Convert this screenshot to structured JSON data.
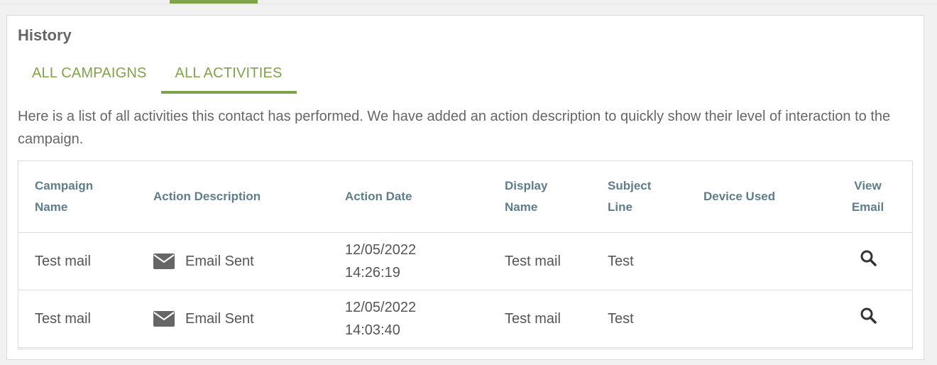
{
  "panel": {
    "title": "History",
    "tabs": [
      {
        "label": "ALL CAMPAIGNS"
      },
      {
        "label": "ALL ACTIVITIES"
      }
    ],
    "description": "Here is a list of all activities this contact has performed. We have added an action description to quickly show their level of interaction to the campaign."
  },
  "table": {
    "headers": {
      "campaign_name_1": "Campaign",
      "campaign_name_2": "Name",
      "action_description": "Action Description",
      "action_date": "Action Date",
      "display_name_1": "Display",
      "display_name_2": "Name",
      "subject_line_1": "Subject",
      "subject_line_2": "Line",
      "device_used": "Device Used",
      "view_email_1": "View",
      "view_email_2": "Email"
    },
    "rows": [
      {
        "campaign": "Test mail",
        "action_icon": "envelope-icon",
        "action": "Email Sent",
        "date": "12/05/2022",
        "time": "14:26:19",
        "display_name": "Test mail",
        "subject": "Test",
        "device": ""
      },
      {
        "campaign": "Test mail",
        "action_icon": "envelope-icon",
        "action": "Email Sent",
        "date": "12/05/2022",
        "time": "14:03:40",
        "display_name": "Test mail",
        "subject": "Test",
        "device": ""
      }
    ]
  },
  "colors": {
    "accent": "#7fa34a",
    "header_text": "#5f7d8a"
  }
}
